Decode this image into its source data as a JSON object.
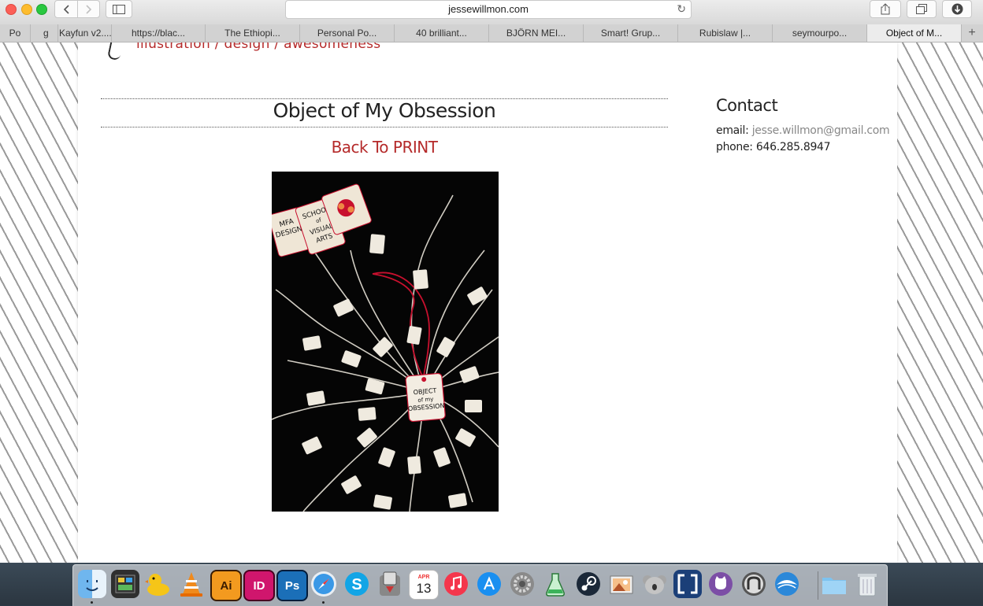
{
  "browser": {
    "url": "jessewillmon.com",
    "tabs": [
      "Po",
      "g",
      "Kayfun v2....",
      "https://blac...",
      "The Ethiopi...",
      "Personal Po...",
      "40 brilliant...",
      "BJÖRN MEI...",
      "Smart! Grup...",
      "Rubislaw |...",
      "seymourpo...",
      "Object of M..."
    ],
    "new_tab_label": "+"
  },
  "page": {
    "tagline": "illustration / design / awesomeness",
    "title": "Object of My Obsession",
    "back_link": "Back To PRINT",
    "contact": {
      "heading": "Contact",
      "email_label": "email:",
      "email": "jesse.willmon@gmail.com",
      "phone_label": "phone:",
      "phone": "646.285.8947"
    },
    "artwork_tags": {
      "main": [
        "OBJECT",
        "of my",
        "OBSESSION"
      ],
      "school": [
        "SCHOOL",
        "of",
        "VISUAL",
        "ARTS"
      ],
      "mfa": [
        "MFA",
        "DESIGN"
      ]
    }
  },
  "dock": {
    "icons": [
      "finder-icon",
      "dashboard-icon",
      "cyberduck-icon",
      "vlc-icon",
      "illustrator-icon",
      "indesign-icon",
      "photoshop-icon",
      "safari-icon",
      "skype-icon",
      "migration-icon",
      "calendar-icon",
      "itunes-icon",
      "app-store-icon",
      "system-preferences-icon",
      "potion-icon",
      "steam-icon",
      "preview-icon",
      "koala-icon",
      "brackets-icon",
      "github-icon",
      "sequel-pro-icon",
      "wunderlist-icon",
      "folder-icon",
      "trash-icon"
    ],
    "calendar_month": "APR",
    "calendar_day": "13",
    "labels": {
      "illustrator": "Ai",
      "indesign": "ID",
      "photoshop": "Ps"
    }
  }
}
